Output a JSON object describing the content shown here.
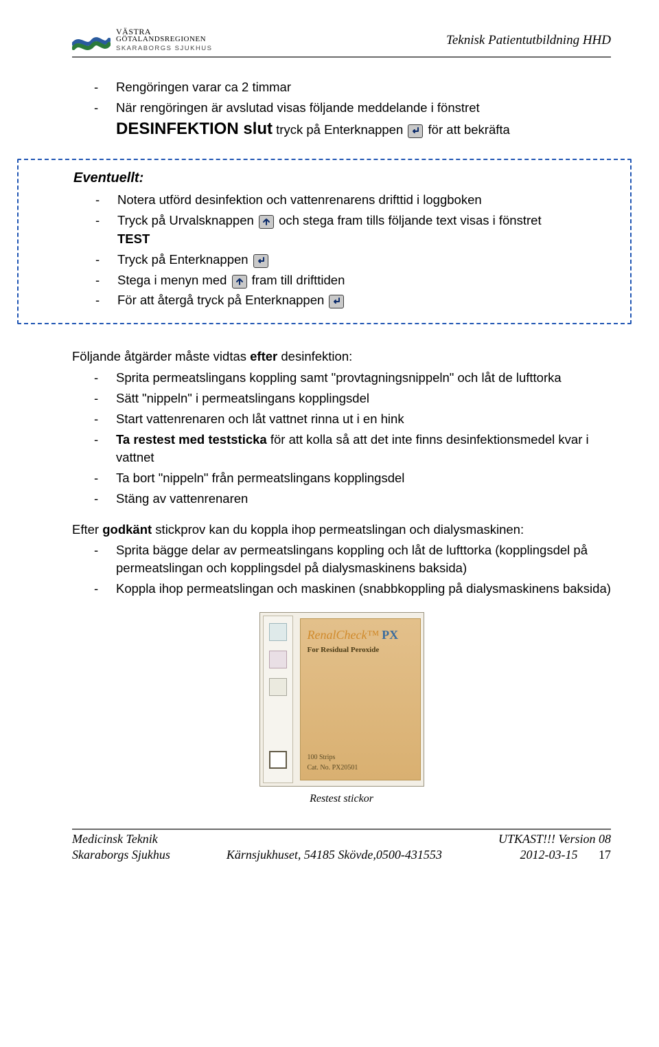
{
  "header": {
    "logo_line1": "VÄSTRA",
    "logo_line2": "GÖTALANDSREGIONEN",
    "logo_line3": "SKARABORGS SJUKHUS",
    "doc_title": "Teknisk Patientutbildning HHD"
  },
  "intro_items": [
    "Rengöringen varar ca 2 timmar",
    "När rengöringen är avslutad visas följande meddelande i fönstret"
  ],
  "desinfektion_line": {
    "bold": "DESINFEKTION slut",
    "after": " tryck på Enterknappen ",
    "tail": " för att bekräfta"
  },
  "eventuellt": {
    "heading": "Eventuellt:",
    "items": [
      {
        "pre": "Notera utförd desinfektion och vattenrenarens drifttid i loggboken"
      },
      {
        "pre": "Tryck på Urvalsknappen ",
        "icon": "up",
        "post": " och stega fram tills följande text visas i fönstret"
      },
      {
        "bold": "TEST"
      },
      {
        "pre": "Tryck på Enterknappen ",
        "icon": "enter"
      },
      {
        "pre": "Stega i menyn med ",
        "icon": "up",
        "post": " fram till drifttiden"
      },
      {
        "pre": "För att återgå tryck på Enterknappen ",
        "icon": "enter"
      }
    ]
  },
  "after_intro": "Följande åtgärder måste vidtas ",
  "after_intro_bold": "efter",
  "after_intro_tail": " desinfektion:",
  "after_items": [
    "Sprita permeatslingans koppling samt \"provtagningsnippeln\" och låt de lufttorka",
    "Sätt \"nippeln\" i permeatslingans kopplingsdel",
    "Start vattenrenaren och låt vattnet rinna ut i en hink",
    {
      "bold": "Ta restest med teststicka",
      "rest": " för att kolla så att det inte finns desinfektionsmedel kvar i vattnet"
    },
    "Ta bort \"nippeln\" från permeatslingans kopplingsdel",
    "Stäng av vattenrenaren"
  ],
  "godkant_intro_pre": "Efter ",
  "godkant_intro_bold": "godkänt",
  "godkant_intro_tail": " stickprov kan du koppla ihop permeatslingan och dialysmaskinen:",
  "godkant_items": [
    "Sprita bägge delar av permeatslingans koppling och låt de lufttorka (kopplingsdel på permeatslingan och kopplingsdel på dialysmaskinens baksida)",
    "Koppla ihop permeatslingan och maskinen (snabbkoppling på dialysmaskinens baksida)"
  ],
  "figure": {
    "brand": "RenalCheck™",
    "brand_px": "PX",
    "subtitle": "For Residual Peroxide",
    "foot1": "100 Strips",
    "foot2": "Cat. No. PX20501",
    "caption": "Restest stickor"
  },
  "footer": {
    "left1": "Medicinsk Teknik",
    "left2": "Skaraborgs Sjukhus",
    "center": "Kärnsjukhuset, 54185 Skövde,0500-431553",
    "right1": "UTKAST!!! Version 08",
    "right2_date": "2012-03-15",
    "right2_page": "17"
  }
}
